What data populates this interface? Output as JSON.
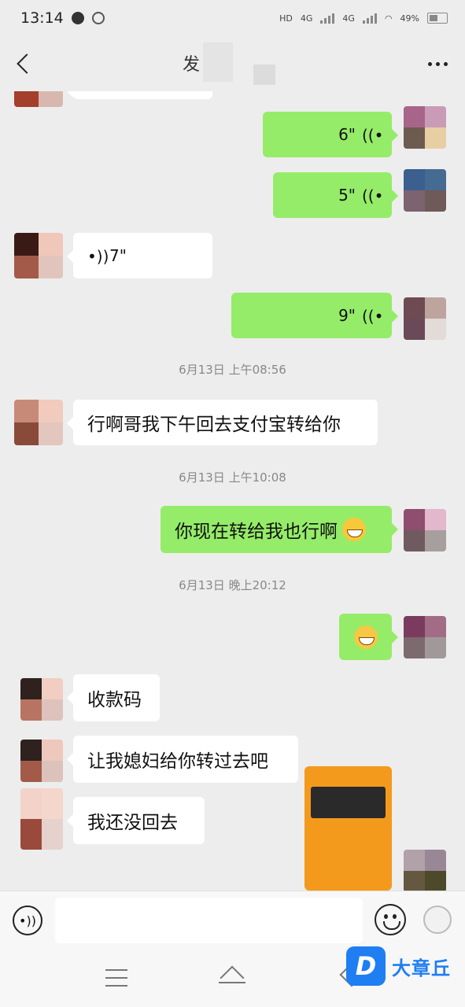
{
  "statusbar": {
    "time": "13:14",
    "network1": "4G",
    "network2": "4G",
    "battery": "49%"
  },
  "header": {
    "title": "发"
  },
  "messages": [
    {
      "id": "m1",
      "from": "me",
      "type": "voice",
      "duration": "6\""
    },
    {
      "id": "m2",
      "from": "me",
      "type": "voice",
      "duration": "5\""
    },
    {
      "id": "m3",
      "from": "them",
      "type": "voice",
      "duration": "7\""
    },
    {
      "id": "m4",
      "from": "me",
      "type": "voice",
      "duration": "9\""
    },
    {
      "id": "t1",
      "type": "time",
      "text": "6月13日 上午08:56"
    },
    {
      "id": "m5",
      "from": "them",
      "type": "text",
      "text": "行啊哥我下午回去支付宝转给你"
    },
    {
      "id": "t2",
      "type": "time",
      "text": "6月13日 上午10:08"
    },
    {
      "id": "m6",
      "from": "me",
      "type": "text",
      "text": "你现在转给我也行啊"
    },
    {
      "id": "t3",
      "type": "time",
      "text": "6月13日 晚上20:12"
    },
    {
      "id": "m7",
      "from": "me",
      "type": "sticker",
      "text": ""
    },
    {
      "id": "m8",
      "from": "them",
      "type": "text",
      "text": "收款码"
    },
    {
      "id": "m9",
      "from": "them",
      "type": "text",
      "text": "让我媳妇给你转过去吧"
    },
    {
      "id": "m10",
      "from": "them",
      "type": "text",
      "text": "我还没回去"
    },
    {
      "id": "m11",
      "from": "me",
      "type": "image",
      "text": ""
    }
  ],
  "input": {
    "value": ""
  },
  "watermark": {
    "logo": "D",
    "text": "大章丘"
  },
  "colors": {
    "outgoing_bubble": "#95ec69",
    "incoming_bubble": "#ffffff",
    "background": "#ededed",
    "watermark": "#1e7ef2"
  }
}
